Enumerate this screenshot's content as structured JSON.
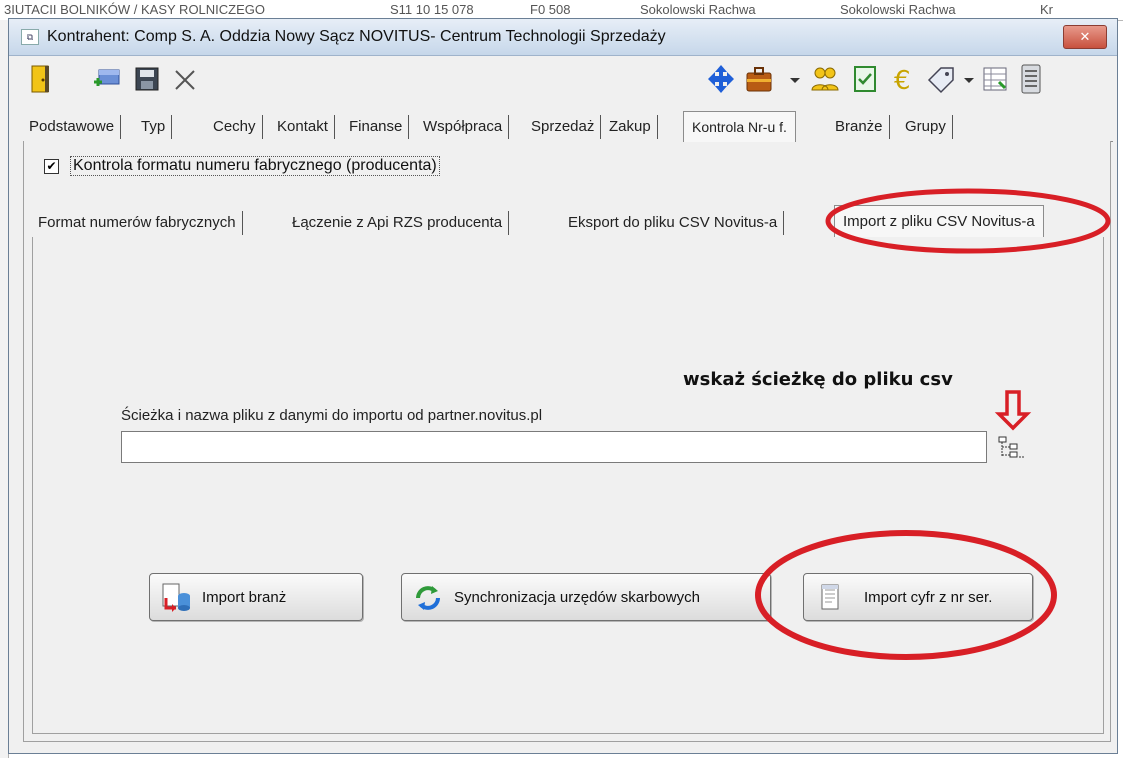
{
  "background_strip": {
    "texts": [
      "3IUTACII BOLNIKÓW / KASY ROLNICZEGO",
      "S11 10 15 078",
      "F0 508",
      "Sokolowski Rachwa",
      "Sokolowski Rachwa",
      "Kr"
    ]
  },
  "window": {
    "title": "Kontrahent: Comp S. A. Oddzia Nowy Sącz NOVITUS- Centrum Technologii Sprzedaży",
    "close_label": "✕"
  },
  "toolbar_icons": [
    "door-icon",
    "add-goods-icon",
    "save-icon",
    "close-x-icon",
    "move-arrows-icon",
    "briefcase-icon",
    "users-icon",
    "checklist-icon",
    "euro-icon",
    "tag-icon",
    "grid-icon",
    "document-list-icon"
  ],
  "main_tabs": [
    "Podstawowe",
    "Typ",
    "Cechy",
    "Kontakt",
    "Finanse",
    "Współpraca",
    "Sprzedaż",
    "Zakup",
    "Kontrola Nr-u f.",
    "Branże",
    "Grupy"
  ],
  "active_main_tab": "Kontrola Nr-u f.",
  "control_checkbox": {
    "checked": true,
    "label": "Kontrola formatu numeru fabrycznego (producenta)"
  },
  "sub_tabs": [
    "Format numerów fabrycznych",
    "Łączenie z Api RZS producenta",
    "Eksport do pliku CSV Novitus-a",
    "Import z pliku CSV Novitus-a"
  ],
  "active_sub_tab": "Import z pliku CSV Novitus-a",
  "annotation_text": "wskaż ścieżkę do pliku csv",
  "import_path": {
    "label": "Ścieżka i nazwa pliku z danymi do importu od partner.novitus.pl",
    "value": "",
    "placeholder": ""
  },
  "buttons": {
    "import_branz": "Import branż",
    "sync_tax_offices": "Synchronizacja urzędów skarbowych",
    "import_digits": "Import cyfr z nr ser."
  },
  "colors": {
    "annotation_red": "#d81f26",
    "titlebar": "#c6d7ea",
    "close_red": "#c8513e"
  }
}
